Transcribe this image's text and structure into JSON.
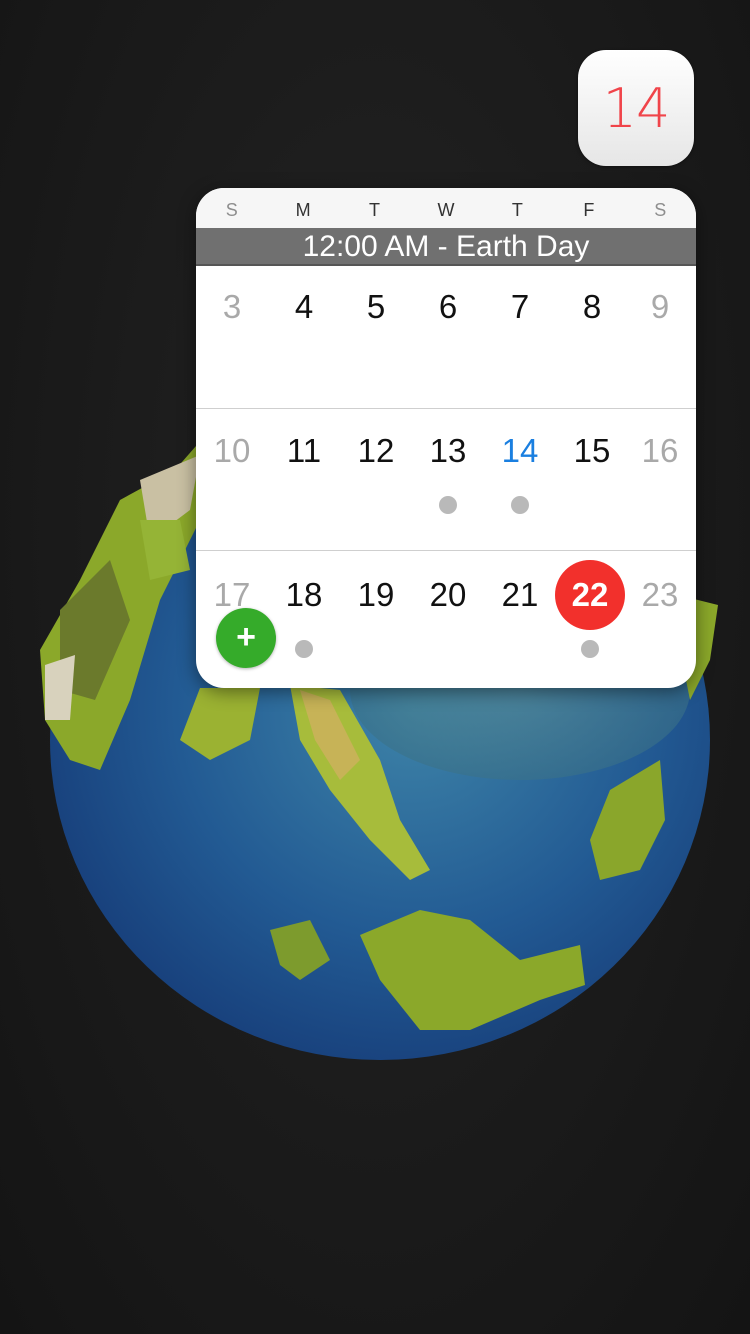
{
  "app_icon": {
    "day": "14",
    "accent": "#f0444a"
  },
  "widget": {
    "weekdays": [
      "S",
      "M",
      "T",
      "W",
      "T",
      "F",
      "S"
    ],
    "event_banner": "12:00 AM - Earth Day",
    "weeks": [
      {
        "days": [
          {
            "num": "3",
            "weekend": true
          },
          {
            "num": "4"
          },
          {
            "num": "5"
          },
          {
            "num": "6"
          },
          {
            "num": "7"
          },
          {
            "num": "8"
          },
          {
            "num": "9",
            "weekend": true
          }
        ]
      },
      {
        "days": [
          {
            "num": "10",
            "weekend": true
          },
          {
            "num": "11"
          },
          {
            "num": "12"
          },
          {
            "num": "13",
            "has_event": true
          },
          {
            "num": "14",
            "today": true,
            "has_event": true
          },
          {
            "num": "15"
          },
          {
            "num": "16",
            "weekend": true
          }
        ]
      },
      {
        "days": [
          {
            "num": "17",
            "weekend": true
          },
          {
            "num": "18",
            "has_event": true
          },
          {
            "num": "19"
          },
          {
            "num": "20"
          },
          {
            "num": "21"
          },
          {
            "num": "22",
            "selected": true,
            "has_event": true
          },
          {
            "num": "23",
            "weekend": true
          }
        ]
      }
    ],
    "colors": {
      "today": "#1a7fe0",
      "selected": "#f2302c",
      "add": "#35ab2a"
    }
  },
  "add_button": {
    "label": "+",
    "icon": "plus-icon"
  }
}
